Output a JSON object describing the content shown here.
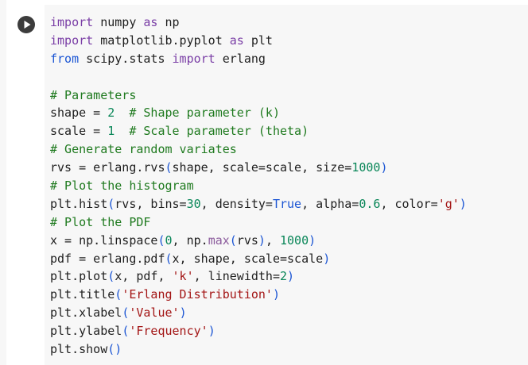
{
  "run_button": {
    "icon": "play-icon"
  },
  "code_lines": [
    [
      {
        "t": "import",
        "c": "kw"
      },
      {
        "t": " numpy "
      },
      {
        "t": "as",
        "c": "kw"
      },
      {
        "t": " np"
      }
    ],
    [
      {
        "t": "import",
        "c": "kw"
      },
      {
        "t": " matplotlib.pyplot "
      },
      {
        "t": "as",
        "c": "kw"
      },
      {
        "t": " plt"
      }
    ],
    [
      {
        "t": "from",
        "c": "kw2"
      },
      {
        "t": " scipy.stats "
      },
      {
        "t": "import",
        "c": "kw"
      },
      {
        "t": " erlang"
      }
    ],
    [],
    [
      {
        "t": "# Parameters",
        "c": "cm"
      }
    ],
    [
      {
        "t": "shape = "
      },
      {
        "t": "2",
        "c": "num"
      },
      {
        "t": "  "
      },
      {
        "t": "# Shape parameter (k)",
        "c": "cm"
      }
    ],
    [
      {
        "t": "scale = "
      },
      {
        "t": "1",
        "c": "num"
      },
      {
        "t": "  "
      },
      {
        "t": "# Scale parameter (theta)",
        "c": "cm"
      }
    ],
    [
      {
        "t": "# Generate random variates",
        "c": "cm"
      }
    ],
    [
      {
        "t": "rvs = erlang.rvs"
      },
      {
        "t": "(",
        "c": "br"
      },
      {
        "t": "shape, scale=scale, size="
      },
      {
        "t": "1000",
        "c": "num"
      },
      {
        "t": ")",
        "c": "br"
      }
    ],
    [
      {
        "t": "# Plot the histogram",
        "c": "cm"
      }
    ],
    [
      {
        "t": "plt.hist"
      },
      {
        "t": "(",
        "c": "br"
      },
      {
        "t": "rvs, bins="
      },
      {
        "t": "30",
        "c": "num"
      },
      {
        "t": ", density="
      },
      {
        "t": "True",
        "c": "kw2"
      },
      {
        "t": ", alpha="
      },
      {
        "t": "0.6",
        "c": "num"
      },
      {
        "t": ", color="
      },
      {
        "t": "'g'",
        "c": "str"
      },
      {
        "t": ")",
        "c": "br"
      }
    ],
    [
      {
        "t": "# Plot the PDF",
        "c": "cm"
      }
    ],
    [
      {
        "t": "x = np.linspace"
      },
      {
        "t": "(",
        "c": "br"
      },
      {
        "t": "0",
        "c": "num"
      },
      {
        "t": ", np."
      },
      {
        "t": "max",
        "c": "fn"
      },
      {
        "t": "(",
        "c": "br"
      },
      {
        "t": "rvs"
      },
      {
        "t": ")",
        "c": "br"
      },
      {
        "t": ", "
      },
      {
        "t": "1000",
        "c": "num"
      },
      {
        "t": ")",
        "c": "br"
      }
    ],
    [
      {
        "t": "pdf = erlang.pdf"
      },
      {
        "t": "(",
        "c": "br"
      },
      {
        "t": "x, shape, scale=scale"
      },
      {
        "t": ")",
        "c": "br"
      }
    ],
    [
      {
        "t": "plt.plot"
      },
      {
        "t": "(",
        "c": "br"
      },
      {
        "t": "x, pdf, "
      },
      {
        "t": "'k'",
        "c": "str"
      },
      {
        "t": ", linewidth="
      },
      {
        "t": "2",
        "c": "num"
      },
      {
        "t": ")",
        "c": "br"
      }
    ],
    [
      {
        "t": "plt.title"
      },
      {
        "t": "(",
        "c": "br"
      },
      {
        "t": "'Erlang Distribution'",
        "c": "str"
      },
      {
        "t": ")",
        "c": "br"
      }
    ],
    [
      {
        "t": "plt.xlabel"
      },
      {
        "t": "(",
        "c": "br"
      },
      {
        "t": "'Value'",
        "c": "str"
      },
      {
        "t": ")",
        "c": "br"
      }
    ],
    [
      {
        "t": "plt.ylabel"
      },
      {
        "t": "(",
        "c": "br"
      },
      {
        "t": "'Frequency'",
        "c": "str"
      },
      {
        "t": ")",
        "c": "br"
      }
    ],
    [
      {
        "t": "plt.show"
      },
      {
        "t": "()",
        "c": "br"
      }
    ]
  ]
}
